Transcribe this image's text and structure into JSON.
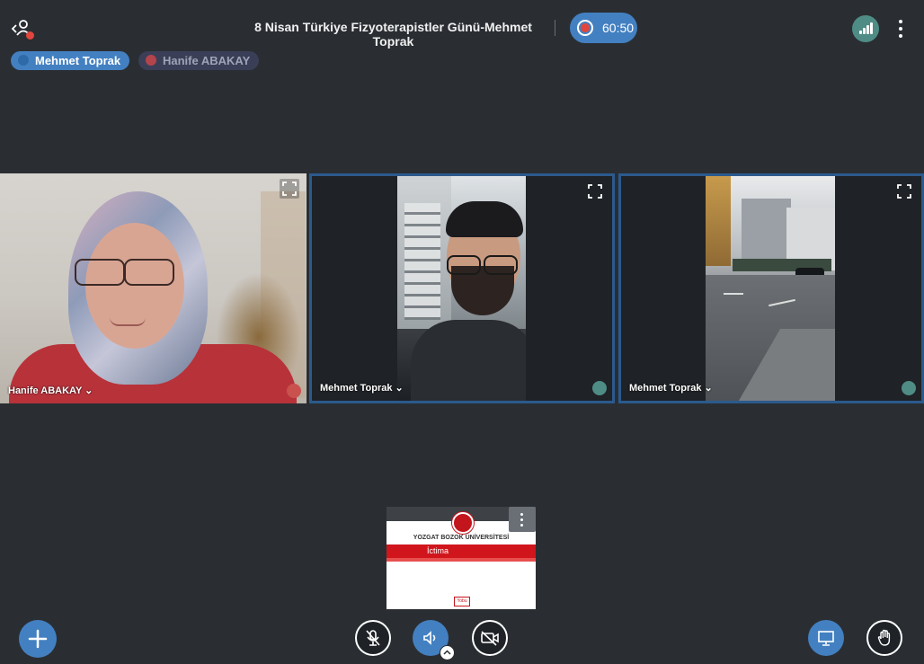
{
  "header": {
    "title": "8 Nisan Türkiye Fizyoterapistler Günü-Mehmet Toprak",
    "recording_time": "60:50"
  },
  "talkers": [
    {
      "name": "Mehmet Toprak"
    },
    {
      "name": "Hanife ABAKAY"
    }
  ],
  "videos": [
    {
      "name": "Hanife ABAKAY ⌄",
      "muted": true
    },
    {
      "name": "Mehmet Toprak ⌄",
      "muted": false
    },
    {
      "name": "Mehmet Toprak ⌄",
      "muted": false
    }
  ],
  "presentation": {
    "university": "YOZGAT BOZOK ÜNİVERSİTESİ",
    "band_text": "İctima",
    "footer_logo": "Yobu"
  },
  "colors": {
    "background": "#2a2e33",
    "accent_blue": "#4380c1",
    "recording_red": "#e0463c",
    "connection_green": "#4f8c86",
    "active_border": "#2b5a8d"
  },
  "icons": {
    "users": "users-icon",
    "record": "record-icon",
    "connection": "connection-status-icon",
    "more": "more-options-icon",
    "mic": "microphone-icon",
    "muted": "microphone-off-icon",
    "expand": "fullscreen-icon",
    "add": "plus-icon",
    "mute_toggle": "microphone-off-icon",
    "audio": "speaker-icon",
    "camera": "camera-off-icon",
    "presentation": "presentation-icon",
    "raise_hand": "raise-hand-icon"
  }
}
